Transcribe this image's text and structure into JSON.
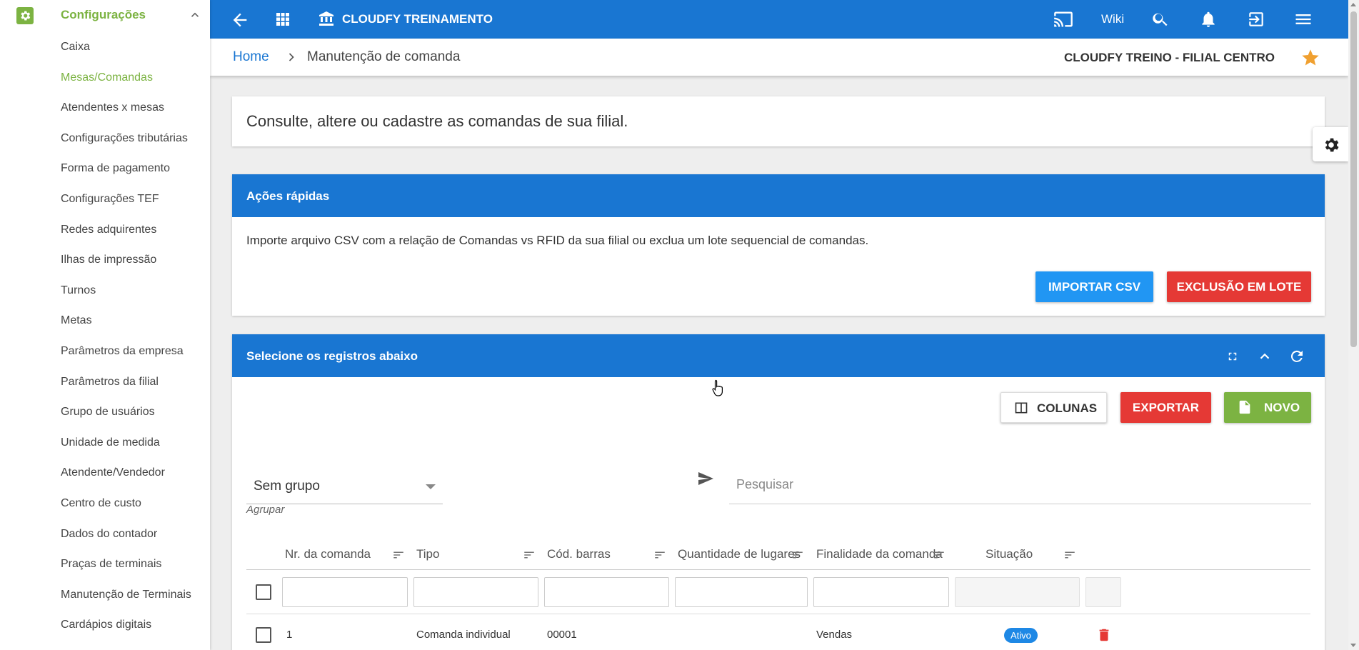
{
  "sidebar": {
    "title": "Configurações",
    "items": [
      {
        "label": "Caixa",
        "active": false
      },
      {
        "label": "Mesas/Comandas",
        "active": true
      },
      {
        "label": "Atendentes x mesas",
        "active": false
      },
      {
        "label": "Configurações tributárias",
        "active": false
      },
      {
        "label": "Forma de pagamento",
        "active": false
      },
      {
        "label": "Configurações TEF",
        "active": false
      },
      {
        "label": "Redes adquirentes",
        "active": false
      },
      {
        "label": "Ilhas de impressão",
        "active": false
      },
      {
        "label": "Turnos",
        "active": false
      },
      {
        "label": "Metas",
        "active": false
      },
      {
        "label": "Parâmetros da empresa",
        "active": false
      },
      {
        "label": "Parâmetros da filial",
        "active": false
      },
      {
        "label": "Grupo de usuários",
        "active": false
      },
      {
        "label": "Unidade de medida",
        "active": false
      },
      {
        "label": "Atendente/Vendedor",
        "active": false
      },
      {
        "label": "Centro de custo",
        "active": false
      },
      {
        "label": "Dados do contador",
        "active": false
      },
      {
        "label": "Praças de terminais",
        "active": false
      },
      {
        "label": "Manutenção de Terminais",
        "active": false
      },
      {
        "label": "Cardápios digitais",
        "active": false
      }
    ]
  },
  "topbar": {
    "brand": "CLOUDFY TREINAMENTO",
    "wiki": "Wiki",
    "icons": [
      "back-arrow-icon",
      "apps-grid-icon",
      "bank-icon",
      "cast-icon",
      "search-icon",
      "bell-icon",
      "logout-icon",
      "menu-icon"
    ]
  },
  "breadcrumb": {
    "home": "Home",
    "page": "Manutenção de comanda",
    "branch": "CLOUDFY TREINO - FILIAL CENTRO"
  },
  "intro": {
    "text": "Consulte, altere ou cadastre as comandas de sua filial."
  },
  "quick_actions": {
    "title": "Ações rápidas",
    "description": "Importe arquivo CSV com a relação de Comandas vs RFID da sua filial ou exclua um lote sequencial de comandas.",
    "import_label": "IMPORTAR CSV",
    "batch_delete_label": "EXCLUSÃO EM LOTE"
  },
  "records": {
    "title": "Selecione os registros abaixo",
    "columns_label": "COLUNAS",
    "export_label": "EXPORTAR",
    "new_label": "NOVO",
    "group_value": "Sem grupo",
    "group_caption": "Agrupar",
    "search_placeholder": "Pesquisar",
    "headers": [
      "Nr. da comanda",
      "Tipo",
      "Cód. barras",
      "Quantidade de lugares",
      "Finalidade da comanda",
      "Situação"
    ],
    "rows": [
      {
        "nr": "1",
        "tipo": "Comanda individual",
        "barras": "00001",
        "lugares": "",
        "finalidade": "Vendas",
        "situacao": "Ativo"
      }
    ]
  },
  "colors": {
    "primary": "#1976d2",
    "accent_green": "#7cb342",
    "danger": "#e53935",
    "info": "#2196f3",
    "star": "#f0a030"
  }
}
